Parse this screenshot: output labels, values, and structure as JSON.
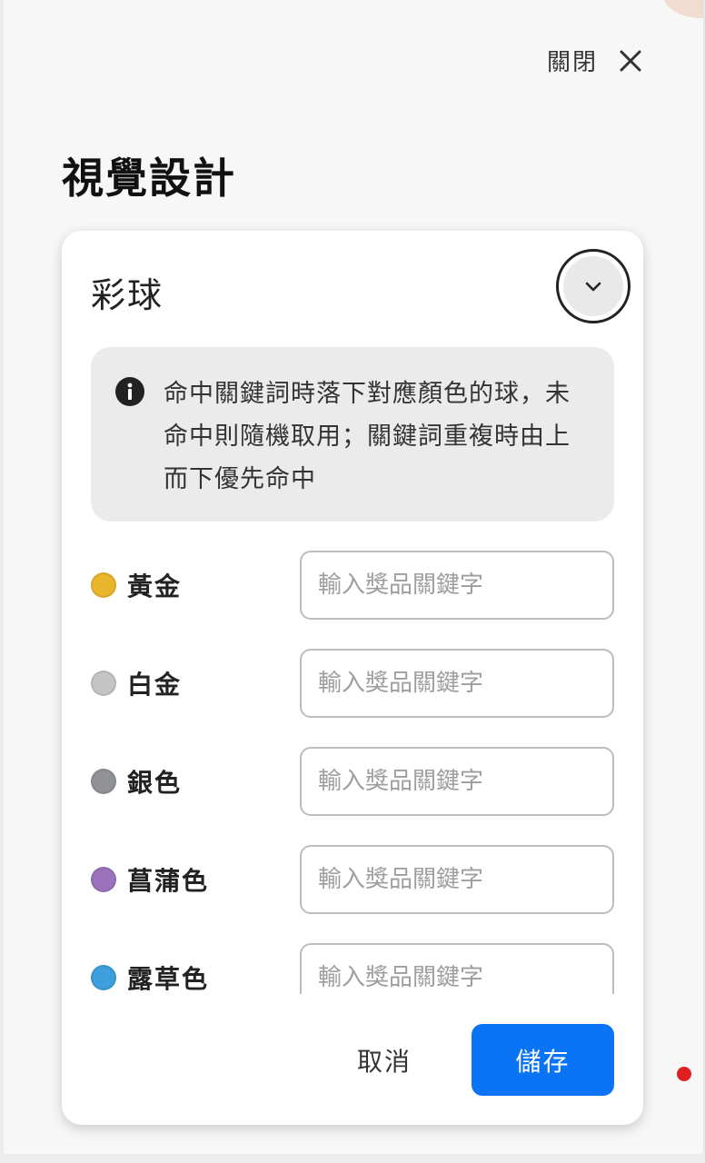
{
  "header": {
    "close_label": "關閉",
    "page_title": "視覺設計"
  },
  "card": {
    "title": "彩球",
    "info_text": "命中關鍵詞時落下對應顏色的球，未命中則隨機取用；關鍵詞重複時由上而下優先命中",
    "items": [
      {
        "name": "黃金",
        "color": "#e9b62b",
        "value": "",
        "placeholder": "輸入獎品關鍵字"
      },
      {
        "name": "白金",
        "color": "#c4c4c4",
        "value": "",
        "placeholder": "輸入獎品關鍵字"
      },
      {
        "name": "銀色",
        "color": "#909296",
        "value": "",
        "placeholder": "輸入獎品關鍵字"
      },
      {
        "name": "菖蒲色",
        "color": "#9b72bc",
        "value": "",
        "placeholder": "輸入獎品關鍵字"
      },
      {
        "name": "露草色",
        "color": "#3d9fdc",
        "value": "",
        "placeholder": "輸入獎品關鍵字"
      }
    ]
  },
  "actions": {
    "cancel_label": "取消",
    "save_label": "儲存"
  },
  "colors": {
    "accent": "#0a74f5",
    "notice_dot": "#e02020",
    "info_background": "#ebebeb"
  },
  "icons": {
    "close": "close-icon",
    "collapse": "chevron-down-icon",
    "info": "info-icon"
  }
}
